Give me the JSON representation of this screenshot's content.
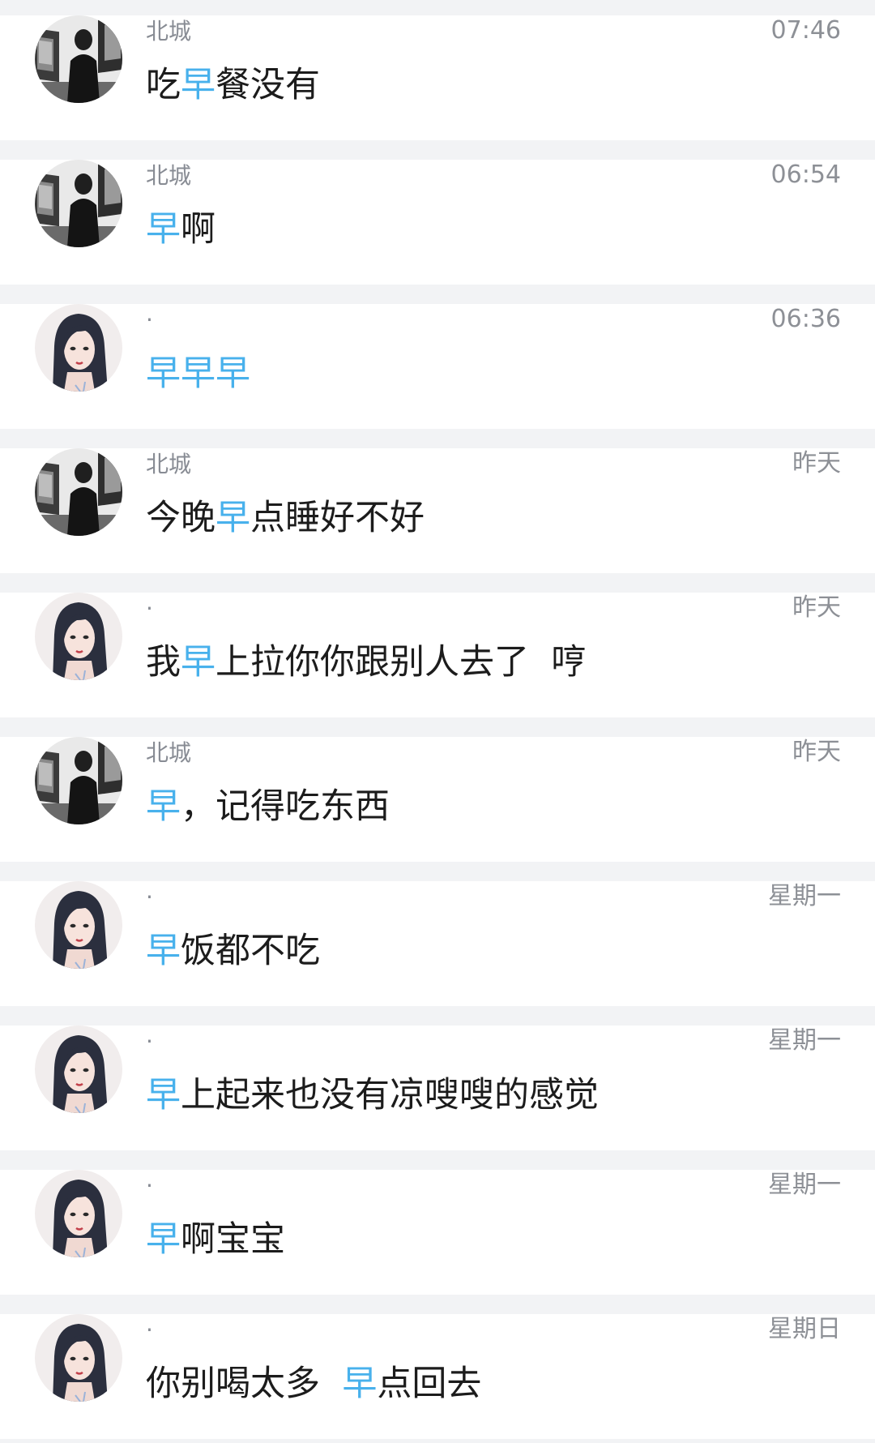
{
  "results": [
    {
      "sender": "北城",
      "avatar": "boy-avatar",
      "time": "07:46",
      "parts": [
        {
          "t": "吃"
        },
        {
          "t": "早",
          "hl": true
        },
        {
          "t": "餐没有"
        }
      ]
    },
    {
      "sender": "北城",
      "avatar": "boy-avatar",
      "time": "06:54",
      "parts": [
        {
          "t": "早",
          "hl": true
        },
        {
          "t": "啊"
        }
      ]
    },
    {
      "sender": "·",
      "avatar": "girl-avatar",
      "time": "06:36",
      "parts": [
        {
          "t": "早",
          "hl": true
        },
        {
          "t": "早",
          "hl": true
        },
        {
          "t": "早",
          "hl": true
        }
      ]
    },
    {
      "sender": "北城",
      "avatar": "boy-avatar",
      "time": "昨天",
      "parts": [
        {
          "t": "今晚"
        },
        {
          "t": "早",
          "hl": true
        },
        {
          "t": "点睡好不好"
        }
      ]
    },
    {
      "sender": "·",
      "avatar": "girl-avatar",
      "time": "昨天",
      "parts": [
        {
          "t": "我"
        },
        {
          "t": "早",
          "hl": true
        },
        {
          "t": "上拉你你跟别人去了  哼"
        }
      ]
    },
    {
      "sender": "北城",
      "avatar": "boy-avatar",
      "time": "昨天",
      "parts": [
        {
          "t": "早",
          "hl": true
        },
        {
          "t": "，记得吃东西"
        }
      ]
    },
    {
      "sender": "·",
      "avatar": "girl-avatar",
      "time": "星期一",
      "parts": [
        {
          "t": "早",
          "hl": true
        },
        {
          "t": "饭都不吃"
        }
      ]
    },
    {
      "sender": "·",
      "avatar": "girl-avatar",
      "time": "星期一",
      "parts": [
        {
          "t": "早",
          "hl": true
        },
        {
          "t": "上起来也没有凉嗖嗖的感觉"
        }
      ]
    },
    {
      "sender": "·",
      "avatar": "girl-avatar",
      "time": "星期一",
      "parts": [
        {
          "t": "早",
          "hl": true
        },
        {
          "t": "啊宝宝"
        }
      ]
    },
    {
      "sender": "·",
      "avatar": "girl-avatar",
      "time": "星期日",
      "parts": [
        {
          "t": "你别喝太多  "
        },
        {
          "t": "早",
          "hl": true
        },
        {
          "t": "点回去"
        }
      ]
    }
  ],
  "colors": {
    "highlight": "#48b1ec",
    "text": "#1c1c1c",
    "meta": "#8d9096",
    "background": "#f2f3f5"
  }
}
